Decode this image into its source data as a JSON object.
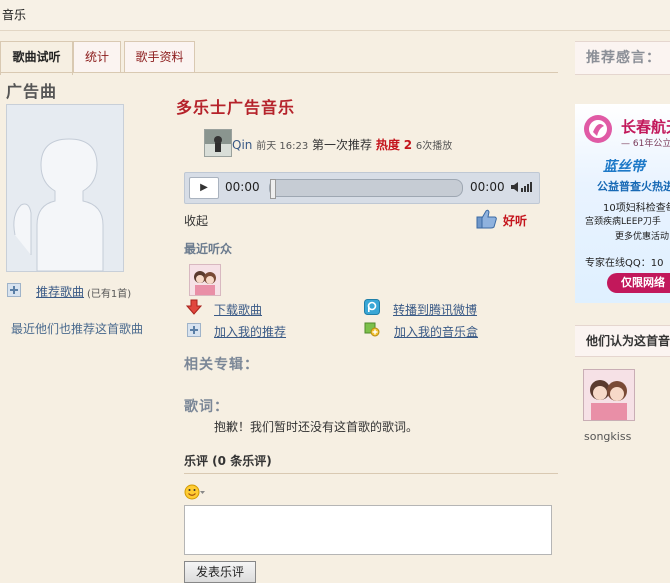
{
  "window": {
    "title": "音乐"
  },
  "tabs": [
    {
      "label": "歌曲试听",
      "active": true
    },
    {
      "label": "统计",
      "active": false
    },
    {
      "label": "歌手资料",
      "active": false
    }
  ],
  "left": {
    "heading": "广告曲",
    "recommend_link": "推荐歌曲",
    "recommend_count": "(已有1首)",
    "note": "最近他们也推荐这首歌曲"
  },
  "song": {
    "title": "多乐士广告音乐",
    "uploader": "Qin",
    "time": "前天 16:23",
    "action": "第一次推荐",
    "heat_label": "热度",
    "heat_value": "2",
    "plays": "6次播放"
  },
  "player": {
    "play_icon": "play-icon",
    "time_current": "00:00",
    "time_total": "00:00",
    "progress": 0
  },
  "controls": {
    "collapse": "收起",
    "like": "好听"
  },
  "listeners": {
    "heading": "最近听众"
  },
  "actions": {
    "download": "下载歌曲",
    "share_weibo": "转播到腾讯微博",
    "add_recommend": "加入我的推荐",
    "add_musicbox": "加入我的音乐盒"
  },
  "album": {
    "heading": "相关专辑："
  },
  "lyrics": {
    "heading": "歌词：",
    "text": "抱歉！我们暂时还没有这首歌的歌词。"
  },
  "comments": {
    "heading": "乐评 (0 条乐评)",
    "submit": "发表乐评"
  },
  "sidebar": {
    "heading": "推荐感言：",
    "ad": {
      "brand": "长春航天",
      "sub": "— 61年公立",
      "ribbon": "蓝丝带",
      "line1": "公益普查火热进",
      "line2": "10项妇科检查每",
      "line3": "宫颈疾病LEEP刀手",
      "line4": "更多优惠活动",
      "line5": "专家在线QQ：10",
      "button": "仅限网络"
    },
    "also_heading": "他们认为这首音",
    "also_user": "songkiss"
  },
  "colors": {
    "accent_red": "#b5222a",
    "heat_red": "#c4141c",
    "link_blue": "#3a5a86",
    "page_bg": "#f6efe2"
  }
}
